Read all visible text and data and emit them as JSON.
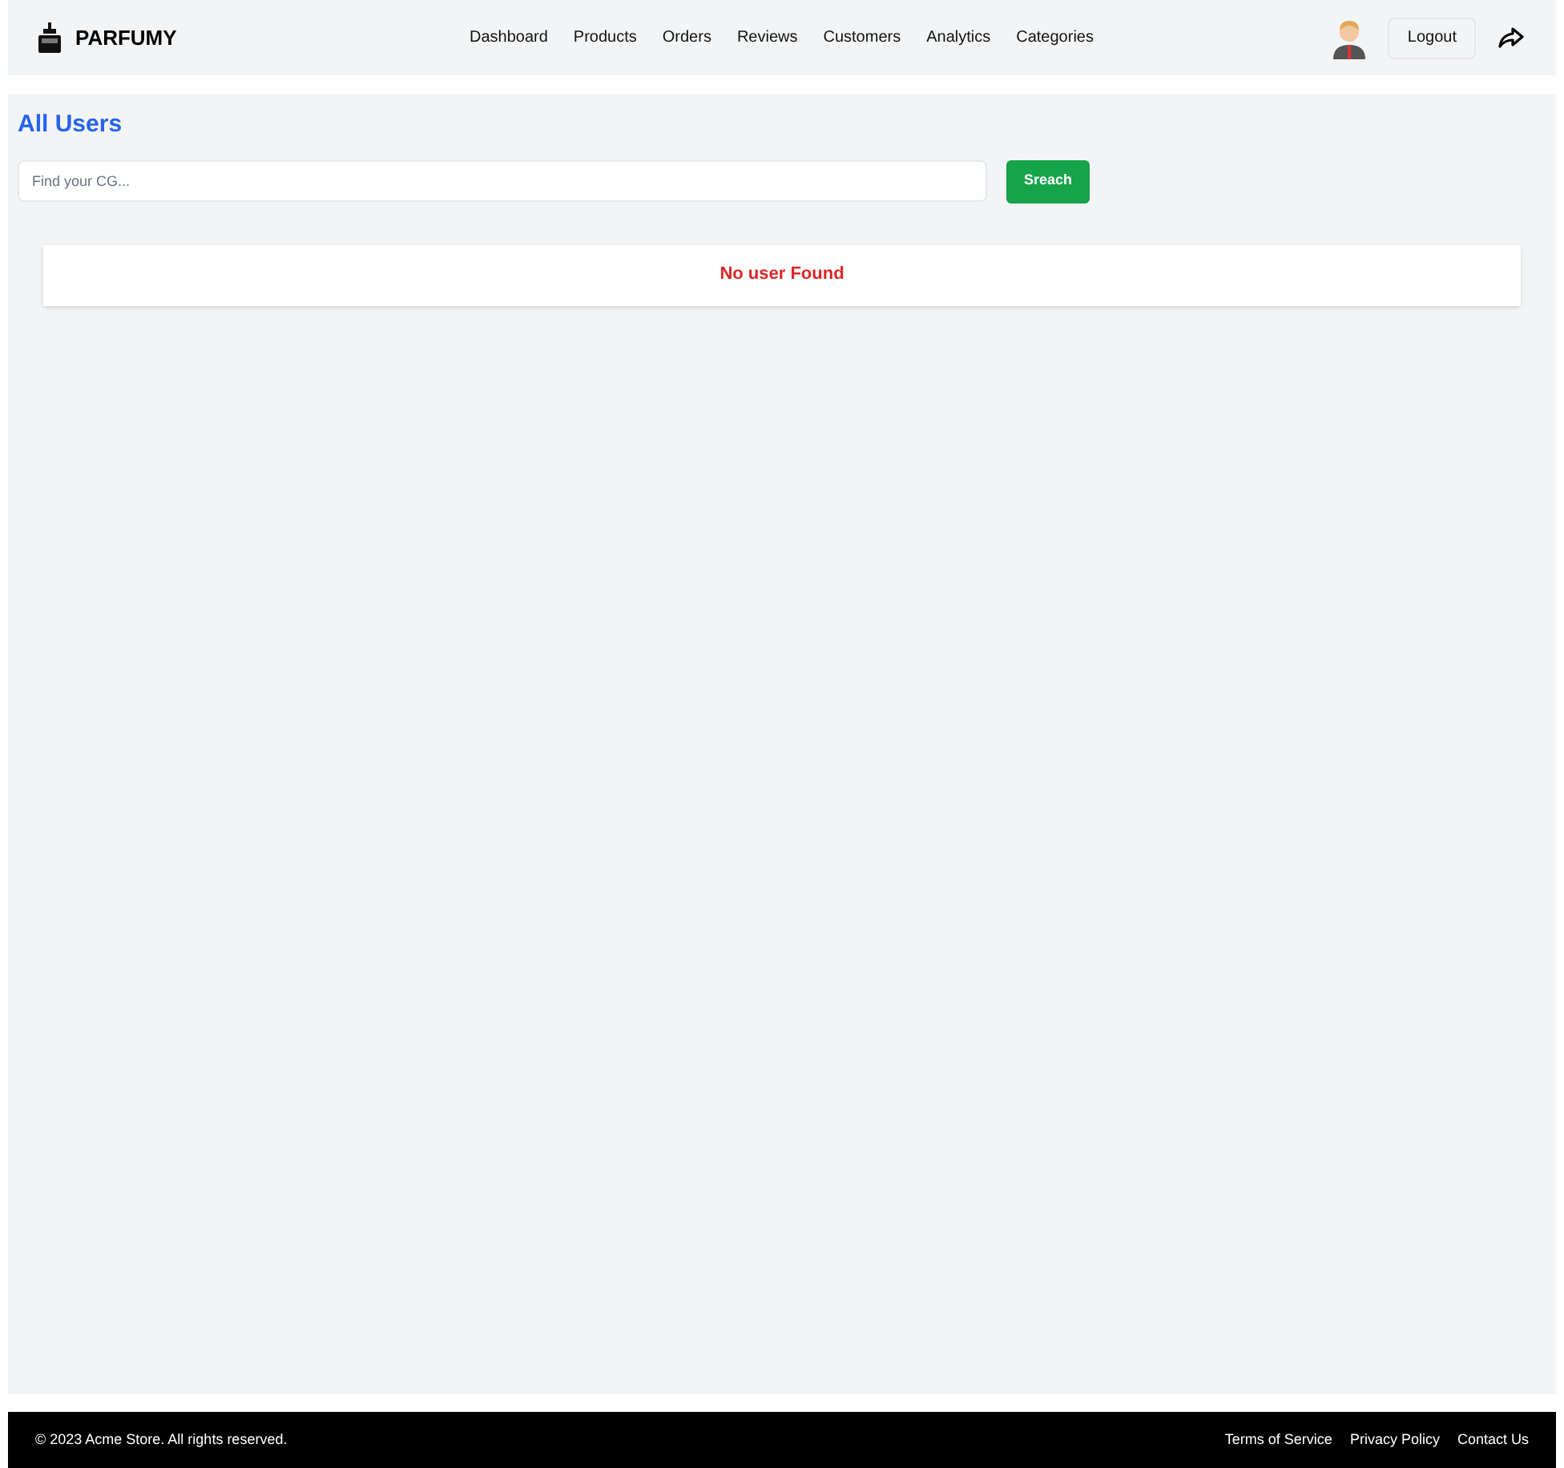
{
  "brand": "PARFUMY",
  "nav": [
    {
      "label": "Dashboard"
    },
    {
      "label": "Products"
    },
    {
      "label": "Orders"
    },
    {
      "label": "Reviews"
    },
    {
      "label": "Customers"
    },
    {
      "label": "Analytics"
    },
    {
      "label": "Categories"
    }
  ],
  "logout": "Logout",
  "title": "All Users",
  "search": {
    "placeholder": "Find your CG..."
  },
  "search_button": "Sreach",
  "empty_message": "No user Found",
  "footer": {
    "copyright": "© 2023 Acme Store. All rights reserved.",
    "links": [
      "Terms of Service",
      "Privacy Policy",
      "Contact Us"
    ]
  }
}
